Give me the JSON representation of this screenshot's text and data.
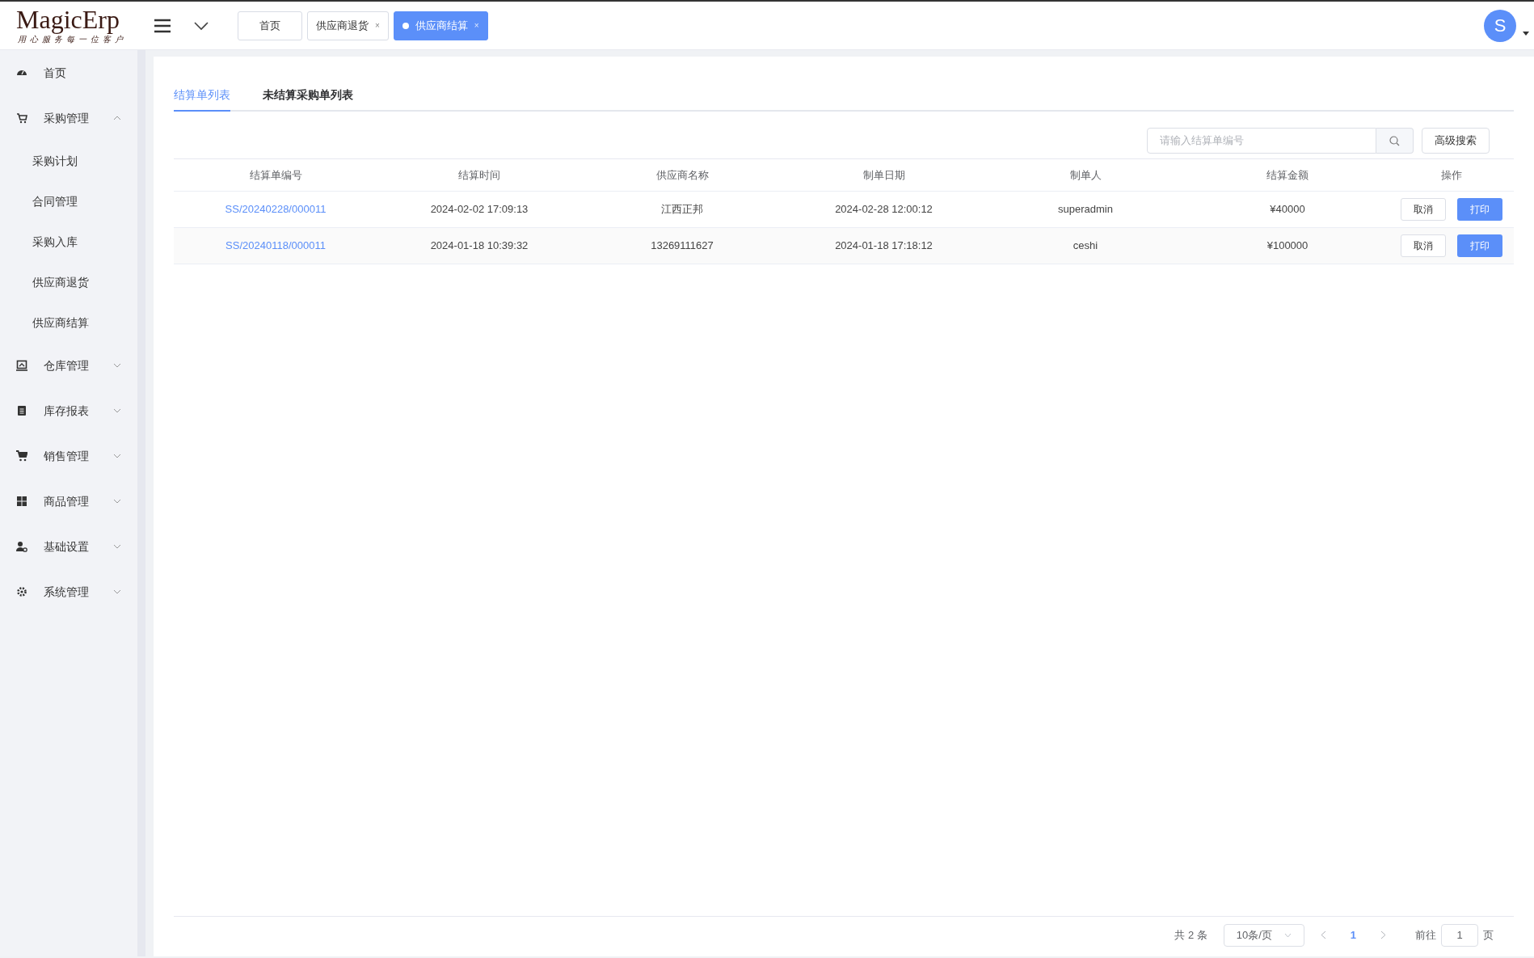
{
  "logo": {
    "title": "MagicErp",
    "slogan": "用心服务每一位客户"
  },
  "nav_tabs": [
    {
      "label": "首页",
      "selected": false,
      "closable": false
    },
    {
      "label": "供应商退货",
      "selected": false,
      "closable": true,
      "close": "×"
    },
    {
      "label": "供应商结算",
      "selected": true,
      "closable": true,
      "close": "×"
    }
  ],
  "avatar": {
    "letter": "S"
  },
  "sidebar": {
    "items": [
      {
        "label": "首页"
      },
      {
        "label": "采购管理",
        "expanded": true,
        "children": [
          {
            "label": "采购计划",
            "selected": false
          },
          {
            "label": "合同管理",
            "selected": false
          },
          {
            "label": "采购入库",
            "selected": false
          },
          {
            "label": "供应商退货",
            "selected": false
          },
          {
            "label": "供应商结算",
            "selected": false
          }
        ]
      },
      {
        "label": "仓库管理",
        "expanded": false
      },
      {
        "label": "库存报表",
        "expanded": false
      },
      {
        "label": "销售管理",
        "expanded": false
      },
      {
        "label": "商品管理",
        "expanded": false
      },
      {
        "label": "基础设置",
        "expanded": false
      },
      {
        "label": "系统管理",
        "expanded": false
      }
    ]
  },
  "tabs": [
    {
      "label": "结算单列表",
      "selected": true
    },
    {
      "label": "未结算采购单列表",
      "selected": false
    }
  ],
  "search": {
    "placeholder": "请输入结算单编号",
    "advanced_button": "高级搜索"
  },
  "table": {
    "columns": [
      "结算单编号",
      "结算时间",
      "供应商名称",
      "制单日期",
      "制单人",
      "结算金额",
      "操作"
    ],
    "rows": [
      {
        "cells": [
          "SS/20240228/000011",
          "2024-02-02 17:09:13",
          "江西正邦",
          "2024-02-28 12:00:12",
          "superadmin",
          "¥40000"
        ],
        "actions": [
          "取消",
          "打印"
        ]
      },
      {
        "cells": [
          "SS/20240118/000011",
          "2024-01-18 10:39:32",
          "13269111627",
          "2024-01-18 17:18:12",
          "ceshi",
          "¥100000"
        ],
        "actions": [
          "取消",
          "打印"
        ]
      }
    ]
  },
  "pagination": {
    "total": "共 2 条",
    "page_size": "10条/页",
    "current_page": "1",
    "goto_label": "前往",
    "goto_value": "1",
    "goto_suffix": "页"
  }
}
